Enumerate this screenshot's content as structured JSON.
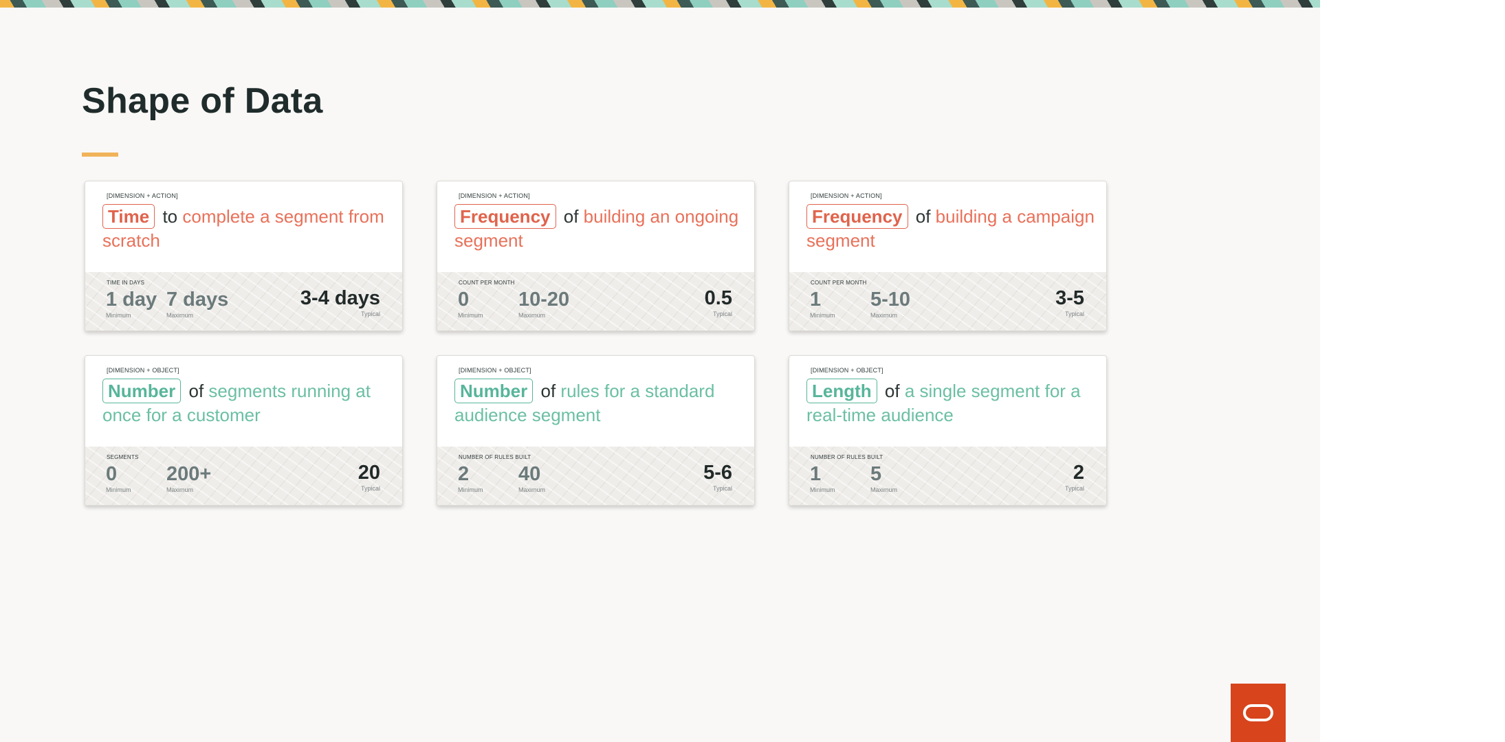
{
  "slide": {
    "title": "Shape of Data",
    "accent_color": "#f0b35a",
    "cards": [
      {
        "kind": "[DIMENSION + ACTION]",
        "tone": "red",
        "keyword": "Time",
        "connector": "to",
        "rest": "complete a segment from scratch",
        "metric": "TIME IN DAYS",
        "min_value": "1 day",
        "min_label": "Minimum",
        "max_value": "7 days",
        "max_label": "Maximum",
        "typical_value": "3-4 days",
        "typical_label": "Typical"
      },
      {
        "kind": "[DIMENSION + ACTION]",
        "tone": "red",
        "keyword": "Frequency",
        "connector": "of",
        "rest": "building an ongoing segment",
        "metric": "COUNT PER MONTH",
        "min_value": "0",
        "min_label": "Minimum",
        "max_value": "10-20",
        "max_label": "Maximum",
        "typical_value": "0.5",
        "typical_label": "Typical"
      },
      {
        "kind": "[DIMENSION + ACTION]",
        "tone": "red",
        "keyword": "Frequency",
        "connector": "of",
        "rest": "building a campaign segment",
        "metric": "COUNT PER MONTH",
        "min_value": "1",
        "min_label": "Minimum",
        "max_value": "5-10",
        "max_label": "Maximum",
        "typical_value": "3-5",
        "typical_label": "Typical"
      },
      {
        "kind": "[DIMENSION + OBJECT]",
        "tone": "green",
        "keyword": "Number",
        "connector": "of",
        "rest": "segments running at once for a customer",
        "metric": "SEGMENTS",
        "min_value": "0",
        "min_label": "Minimum",
        "max_value": "200+",
        "max_label": "Maximum",
        "typical_value": "20",
        "typical_label": "Typical"
      },
      {
        "kind": "[DIMENSION + OBJECT]",
        "tone": "green",
        "keyword": "Number",
        "connector": "of",
        "rest": "rules for a standard audience segment",
        "metric": "NUMBER OF RULES BUILT",
        "min_value": "2",
        "min_label": "Minimum",
        "max_value": "40",
        "max_label": "Maximum",
        "typical_value": "5-6",
        "typical_label": "Typical"
      },
      {
        "kind": "[DIMENSION + OBJECT]",
        "tone": "green",
        "keyword": "Length",
        "connector": "of",
        "rest": "a single segment for a real-time audience",
        "metric": "NUMBER OF RULES BUILT",
        "min_value": "1",
        "min_label": "Minimum",
        "max_value": "5",
        "max_label": "Maximum",
        "typical_value": "2",
        "typical_label": "Typical"
      }
    ],
    "logo_icon": "oracle-logo-icon",
    "logo_color": "#d8441c"
  }
}
